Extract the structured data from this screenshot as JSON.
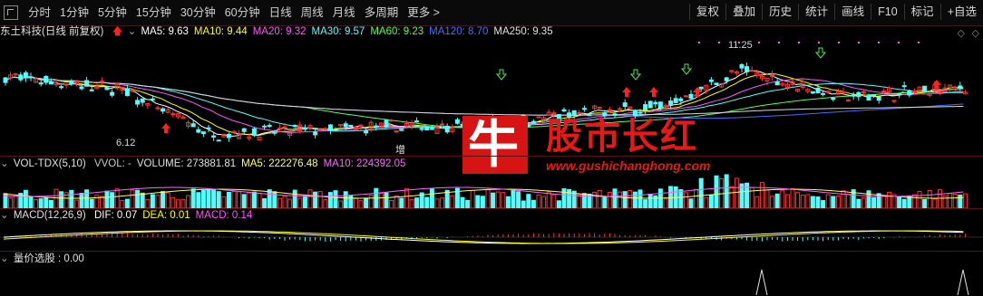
{
  "toolbar": {
    "periods": [
      "分时",
      "1分钟",
      "5分钟",
      "15分钟",
      "30分钟",
      "60分钟",
      "日线",
      "周线",
      "月线",
      "多周期",
      "更多 >"
    ],
    "actions": [
      "复权",
      "叠加",
      "历史",
      "统计",
      "画线",
      "F10",
      "标记",
      "+自选"
    ]
  },
  "main_header": {
    "stock": "东土科技",
    "mode": "(日线 前复权)",
    "ma": [
      {
        "label": "MA5: 9.63",
        "color": "#ffffff"
      },
      {
        "label": "MA10: 9.44",
        "color": "#ffff00"
      },
      {
        "label": "MA20: 9.32",
        "color": "#ff55ff"
      },
      {
        "label": "MA30: 9.57",
        "color": "#55ffff"
      },
      {
        "label": "MA60: 9.23",
        "color": "#55ff55"
      },
      {
        "label": "MA120: 8.70",
        "color": "#4a6cff"
      },
      {
        "label": "MA250: 9.35",
        "color": "#e0e0e0"
      }
    ],
    "high_label": "11.25",
    "low_label": "6.12",
    "zeng_label": "增"
  },
  "vol_header": {
    "title": "VOL-TDX(5,10)",
    "items": [
      {
        "label": "VVOL: -",
        "color": "#c8c8c8"
      },
      {
        "label": "VOLUME: 273881.81",
        "color": "#e0e0e0"
      },
      {
        "label": "MA5: 222276.48",
        "color": "#ffff66"
      },
      {
        "label": "MA10: 224392.05",
        "color": "#ff66ff"
      }
    ]
  },
  "macd_header": {
    "title": "MACD(12,26,9)",
    "items": [
      {
        "label": "DIF: 0.07",
        "color": "#ffffff"
      },
      {
        "label": "DEA: 0.01",
        "color": "#ffff00"
      },
      {
        "label": "MACD: 0.14",
        "color": "#ff55ff"
      }
    ]
  },
  "lzx_header": {
    "title": "量价选股 : 0.00"
  },
  "watermark": {
    "char": "牛",
    "text": "股市长红",
    "url": "www.gushichanghong.com"
  }
}
